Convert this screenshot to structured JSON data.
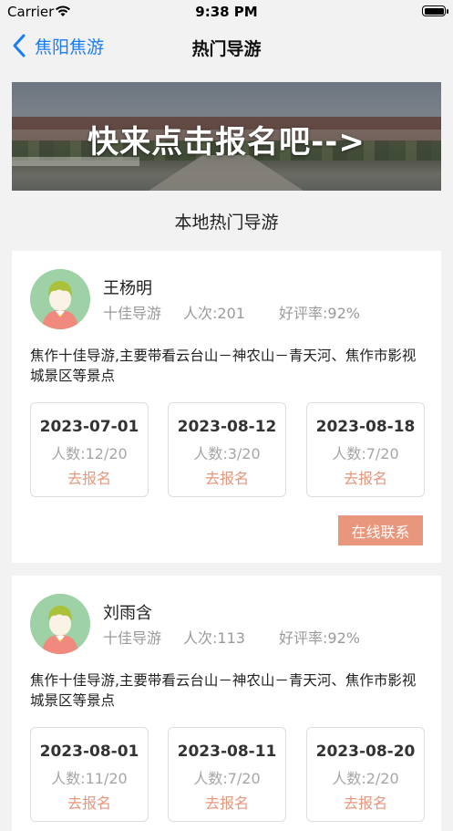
{
  "status_bar": {
    "carrier": "Carrier",
    "time": "9:38 PM"
  },
  "nav": {
    "back_label": "焦阳焦游",
    "title": "热门导游"
  },
  "banner": {
    "text": "快来点击报名吧-->"
  },
  "section": {
    "title": "本地热门导游"
  },
  "guides": [
    {
      "name": "王杨明",
      "title": "十佳导游",
      "count": "人次:201",
      "rating": "好评率:92%",
      "description": "焦作十佳导游,主要带看云台山－神农山－青天河、焦作市影视城景区等景点",
      "schedule": [
        {
          "date": "2023-07-01",
          "people": "人数:12/20",
          "action": "去报名"
        },
        {
          "date": "2023-08-12",
          "people": "人数:3/20",
          "action": "去报名"
        },
        {
          "date": "2023-08-18",
          "people": "人数:7/20",
          "action": "去报名"
        }
      ],
      "contact_label": "在线联系"
    },
    {
      "name": "刘雨含",
      "title": "十佳导游",
      "count": "人次:113",
      "rating": "好评率:92%",
      "description": "焦作十佳导游,主要带看云台山－神农山－青天河、焦作市影视城景区等景点",
      "schedule": [
        {
          "date": "2023-08-01",
          "people": "人数:11/20",
          "action": "去报名"
        },
        {
          "date": "2023-08-11",
          "people": "人数:7/20",
          "action": "去报名"
        },
        {
          "date": "2023-08-20",
          "people": "人数:2/20",
          "action": "去报名"
        }
      ]
    }
  ],
  "colors": {
    "accent": "#e8967c",
    "link": "#1a7cf5",
    "background": "#f2f2f2"
  },
  "icons": {
    "back": "chevron-left-icon",
    "wifi": "wifi-icon",
    "battery": "battery-icon",
    "avatar": "person-avatar-icon"
  }
}
